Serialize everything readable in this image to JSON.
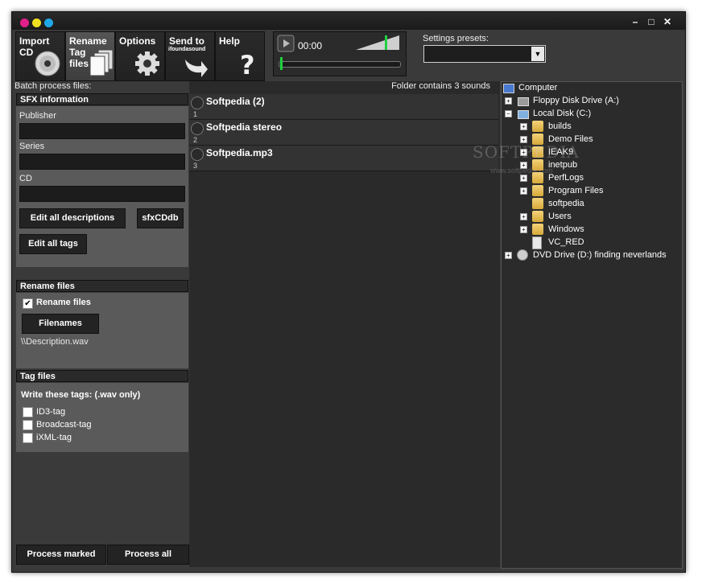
{
  "toolbar": {
    "import_cd": "Import\nCD",
    "rename": "Rename\nTag\nfiles",
    "options": "Options",
    "send_to": "Send to",
    "send_to_sub": "ifoundasound",
    "help": "Help"
  },
  "player": {
    "time": "00:00"
  },
  "presets": {
    "label": "Settings presets:",
    "value": ""
  },
  "left": {
    "batch_label": "Batch process files:",
    "sfx_header": "SFX information",
    "publisher_label": "Publisher",
    "publisher_value": "",
    "series_label": "Series",
    "series_value": "",
    "cd_label": "CD",
    "cd_value": "",
    "edit_all_descriptions": "Edit all descriptions",
    "sfxcddb": "sfxCDdb",
    "edit_all_tags": "Edit all tags",
    "rename_header": "Rename files",
    "rename_checkbox": "Rename files",
    "rename_checked": true,
    "filenames_button": "Filenames",
    "filename_pattern": "\\\\Description.wav",
    "tag_header": "Tag files",
    "write_tags_label": "Write these tags: (.wav only)",
    "tags": [
      {
        "label": "ID3-tag",
        "checked": false
      },
      {
        "label": "Broadcast-tag",
        "checked": false
      },
      {
        "label": "iXML-tag",
        "checked": false
      }
    ],
    "process_marked": "Process marked",
    "process_all": "Process all"
  },
  "middle": {
    "folder_info": "Folder contains 3 sounds",
    "sounds": [
      {
        "name": "Softpedia (2)",
        "num": "1"
      },
      {
        "name": "Softpedia stereo",
        "num": "2"
      },
      {
        "name": "Softpedia.mp3",
        "num": "3"
      }
    ]
  },
  "tree": {
    "root": "Computer",
    "floppy": "Floppy Disk Drive (A:)",
    "local_disk": "Local Disk (C:)",
    "folders": [
      "builds",
      "Demo Files",
      "IEAK9",
      "inetpub",
      "PerfLogs",
      "Program Files",
      "softpedia",
      "Users",
      "Windows",
      "VC_RED"
    ],
    "dvd": "DVD Drive (D:) finding neverlands"
  },
  "watermark": {
    "main": "SOFTPEDIA",
    "sub": "www.softpedia.com"
  },
  "colors": {
    "pink": "#e0208a",
    "yellow": "#f0e020",
    "cyan": "#20a8e8",
    "green": "#20d040"
  }
}
